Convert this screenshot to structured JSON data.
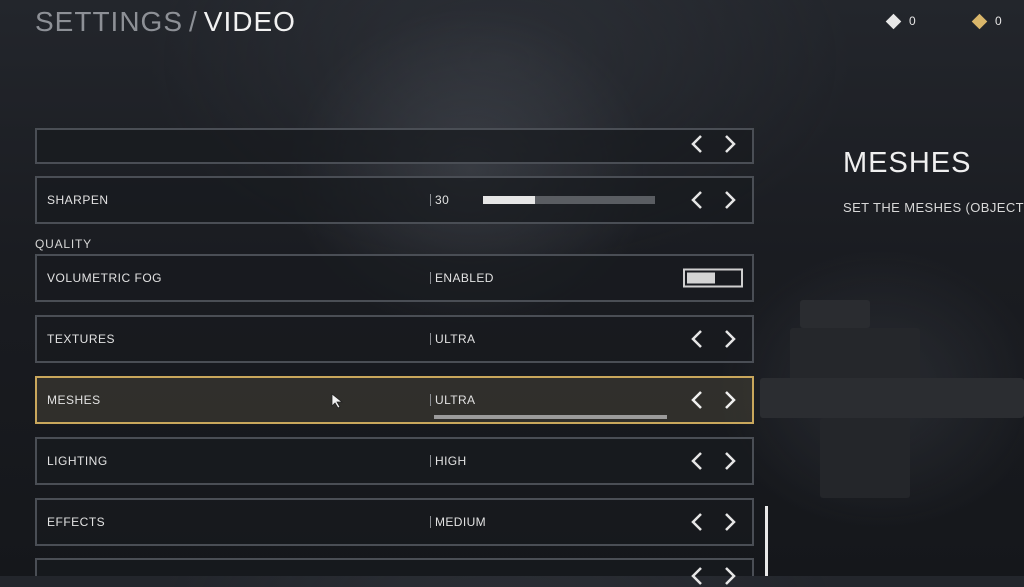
{
  "header": {
    "breadcrumb_parent": "SETTINGS",
    "separator": "/",
    "current_page": "VIDEO"
  },
  "currencies": [
    {
      "icon": "white-diamond-icon",
      "color": "#e8e8e8",
      "value": "0"
    },
    {
      "icon": "gold-diamond-icon",
      "color": "#d9b66a",
      "value": "0"
    }
  ],
  "settings": {
    "sharpen": {
      "label": "SHARPEN",
      "value": "30",
      "slider_percent": 30
    },
    "quality_section": "QUALITY",
    "volumetric_fog": {
      "label": "VOLUMETRIC FOG",
      "value": "ENABLED",
      "toggle_on": true
    },
    "textures": {
      "label": "TEXTURES",
      "value": "ULTRA"
    },
    "meshes": {
      "label": "MESHES",
      "value": "ULTRA",
      "selected": true,
      "level_fraction": 1.0
    },
    "lighting": {
      "label": "LIGHTING",
      "value": "HIGH"
    },
    "effects": {
      "label": "EFFECTS",
      "value": "MEDIUM"
    }
  },
  "detail": {
    "title": "MESHES",
    "description": "SET THE MESHES (OBJECTS)"
  },
  "colors": {
    "accent_selected": "#c9a75c",
    "panel_border": "#4a4e55"
  }
}
